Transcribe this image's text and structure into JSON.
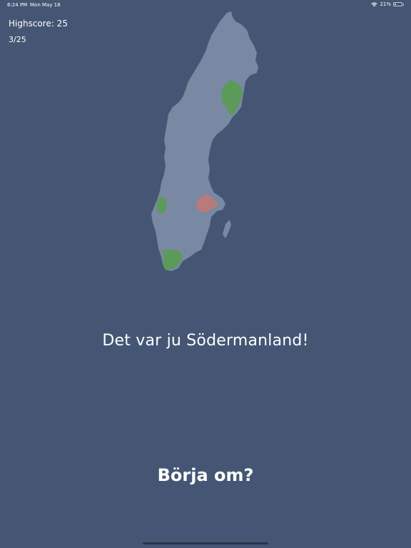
{
  "status_bar": {
    "time": "6:24 PM",
    "date": "Mon May 18",
    "battery": "21%",
    "battery_level": 0.21,
    "wifi_icon": "wifi-icon",
    "battery_icon": "battery-icon"
  },
  "game": {
    "highscore": "Highscore: 25",
    "progress": "3/25",
    "message": "Det var ju Södermanland!",
    "restart_label": "Börja om?"
  },
  "colors": {
    "background": "#445673",
    "country": "#7988a3",
    "correct": "#5c9a5a",
    "wrong": "#b87a7a"
  }
}
